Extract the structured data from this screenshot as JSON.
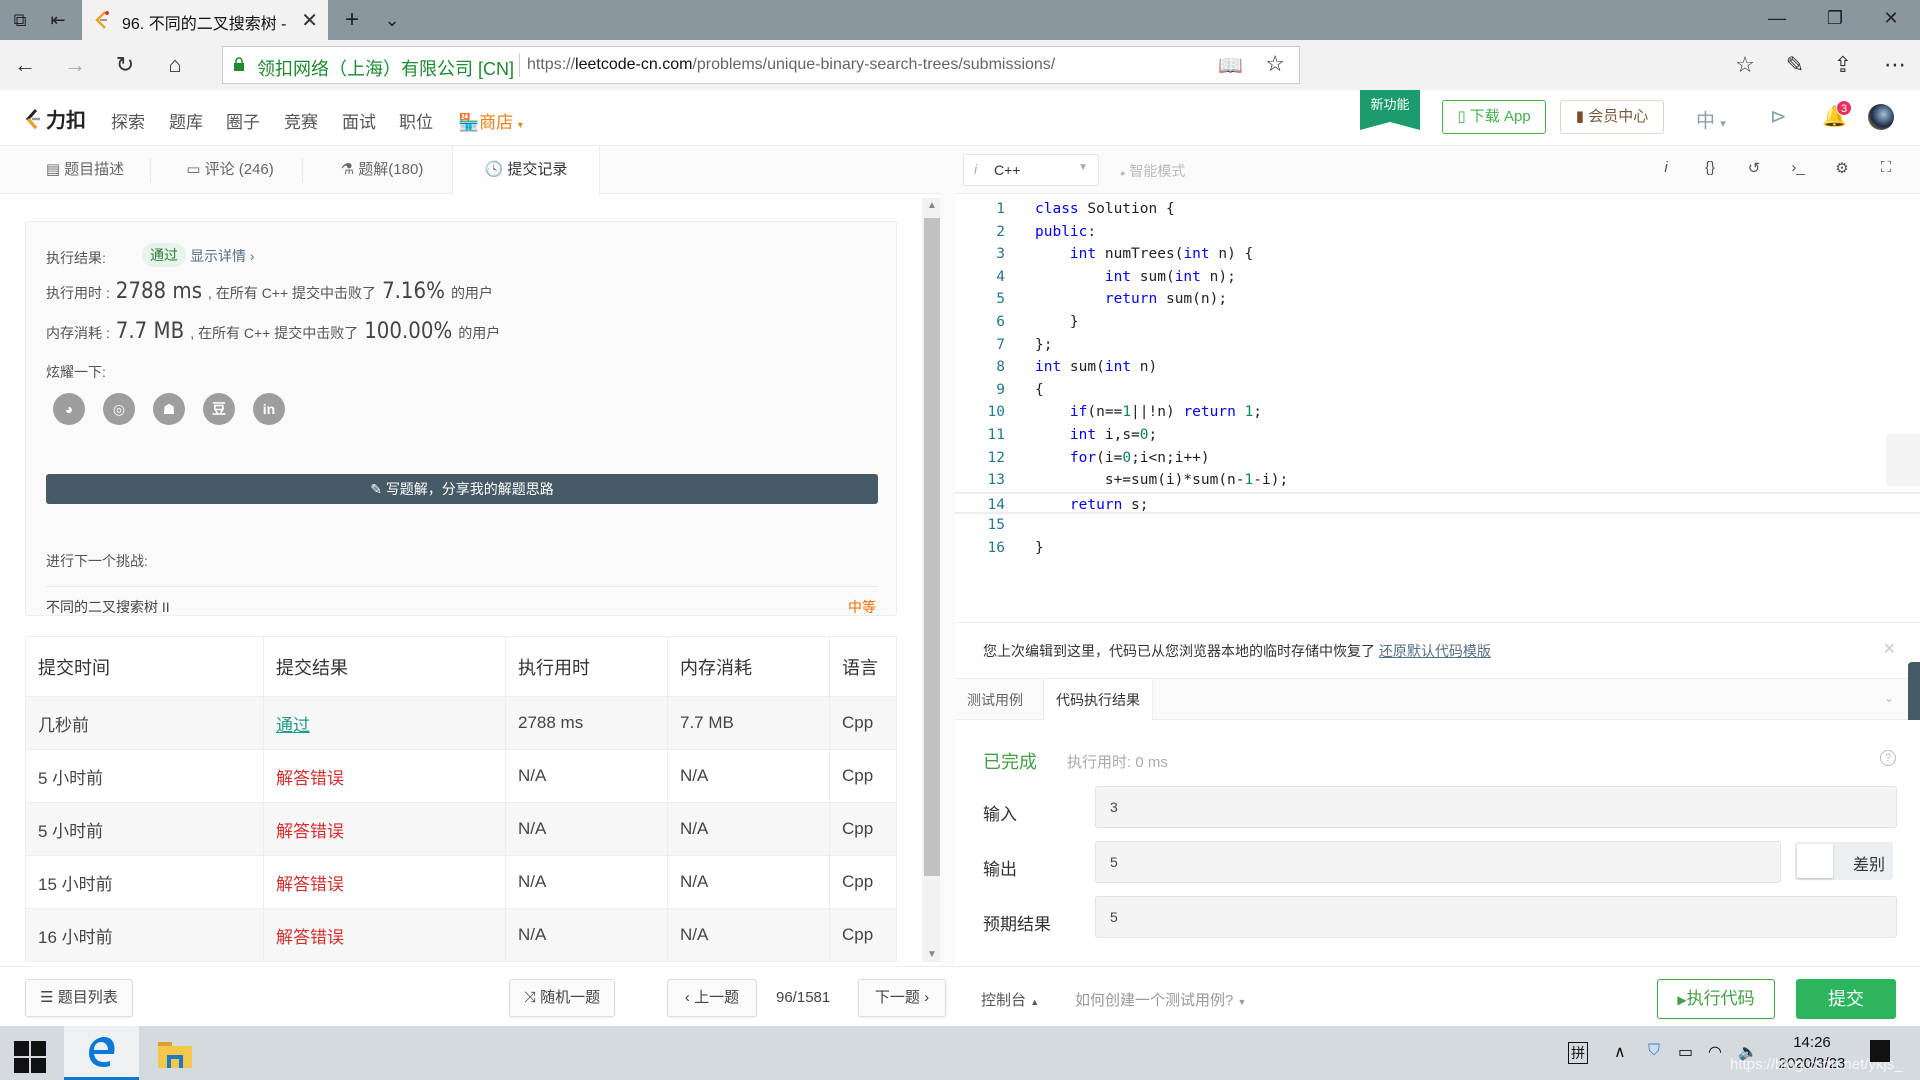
{
  "browser": {
    "tab_title": "96. 不同的二叉搜索树 -",
    "new_tab": "+",
    "tab_list": "⌄",
    "site_identity": "领扣网络（上海）有限公司 [CN]",
    "url_prefix": "https://",
    "url_domain": "leetcode-cn.com",
    "url_path": "/problems/unique-binary-search-trees/submissions/"
  },
  "header": {
    "brand": "力扣",
    "menu": [
      "探索",
      "题库",
      "圈子",
      "竞赛",
      "面试",
      "职位"
    ],
    "store": "商店",
    "new_feature": "新功能",
    "download_app": "下载 App",
    "vip_center": "会员中心",
    "language": "中",
    "notification_count": "3"
  },
  "left_tabs": [
    {
      "label": "题目描述"
    },
    {
      "label": "评论 (246)"
    },
    {
      "label": "题解(180)"
    },
    {
      "label": "提交记录",
      "active": true
    }
  ],
  "result": {
    "status_label": "执行结果:",
    "status": "通过",
    "show_details": "显示详情",
    "runtime_label": "执行用时 :",
    "runtime_value": "2788 ms",
    "runtime_mid": ", 在所有 C++ 提交中击败了",
    "runtime_pct": "7.16%",
    "runtime_suffix": "的用户",
    "memory_label": "内存消耗 :",
    "memory_value": "7.7 MB",
    "memory_mid": ", 在所有 C++ 提交中击败了",
    "memory_pct": "100.00%",
    "memory_suffix": "的用户",
    "share_label": "炫耀一下:",
    "share_icons": [
      "wechat",
      "weibo",
      "qq",
      "douban",
      "linkedin"
    ],
    "write_solution": "写题解，分享我的解题思路",
    "next_label": "进行下一个挑战:",
    "next_problem": "不同的二叉搜索树 II",
    "next_difficulty": "中等"
  },
  "submissions": {
    "columns": [
      "提交时间",
      "提交结果",
      "执行用时",
      "内存消耗",
      "语言"
    ],
    "rows": [
      {
        "time": "几秒前",
        "result": "通过",
        "status": "ok",
        "runtime": "2788 ms",
        "memory": "7.7 MB",
        "lang": "Cpp"
      },
      {
        "time": "5 小时前",
        "result": "解答错误",
        "status": "err",
        "runtime": "N/A",
        "memory": "N/A",
        "lang": "Cpp"
      },
      {
        "time": "5 小时前",
        "result": "解答错误",
        "status": "err",
        "runtime": "N/A",
        "memory": "N/A",
        "lang": "Cpp"
      },
      {
        "time": "15 小时前",
        "result": "解答错误",
        "status": "err",
        "runtime": "N/A",
        "memory": "N/A",
        "lang": "Cpp"
      },
      {
        "time": "16 小时前",
        "result": "解答错误",
        "status": "err",
        "runtime": "N/A",
        "memory": "N/A",
        "lang": "Cpp"
      }
    ]
  },
  "left_bottom": {
    "problem_list": "题目列表",
    "random": "随机一题",
    "prev": "上一题",
    "pager": "96/1581",
    "next": "下一题"
  },
  "editor": {
    "language": "C++",
    "smart_mode": "智能模式",
    "current_line": 14,
    "lines": [
      "class Solution {",
      "public:",
      "    int numTrees(int n) {",
      "        int sum(int n);",
      "        return sum(n);",
      "    }",
      "};",
      "int sum(int n)",
      "{",
      "    if(n==1||!n) return 1;",
      "    int i,s=0;",
      "    for(i=0;i<n;i++)",
      "        s+=sum(i)*sum(n-1-i);",
      "    return s;",
      "",
      "}"
    ]
  },
  "notice": {
    "text": "您上次编辑到这里，代码已从您浏览器本地的临时存储中恢复了",
    "link": "还原默认代码模版"
  },
  "console": {
    "tabs": [
      {
        "label": "测试用例"
      },
      {
        "label": "代码执行结果",
        "active": true
      }
    ],
    "status": "已完成",
    "exec_time": "执行用时: 0 ms",
    "input_label": "输入",
    "input_value": "3",
    "output_label": "输出",
    "output_value": "5",
    "expected_label": "预期结果",
    "expected_value": "5",
    "diff_label": "差别"
  },
  "right_bottom": {
    "console": "控制台",
    "howto": "如何创建一个测试用例?",
    "run": "执行代码",
    "submit": "提交"
  },
  "taskbar": {
    "ime": "拼",
    "time": "14:26",
    "date": "2020/3/23",
    "watermark": "https://blog.csdn.net/ykjs_"
  },
  "colors": {
    "accent_green": "#2db55d",
    "pass_teal": "#1e9d87",
    "error_red": "#d32f2f",
    "store_orange": "#f07f12",
    "write_btn": "#455a64"
  }
}
